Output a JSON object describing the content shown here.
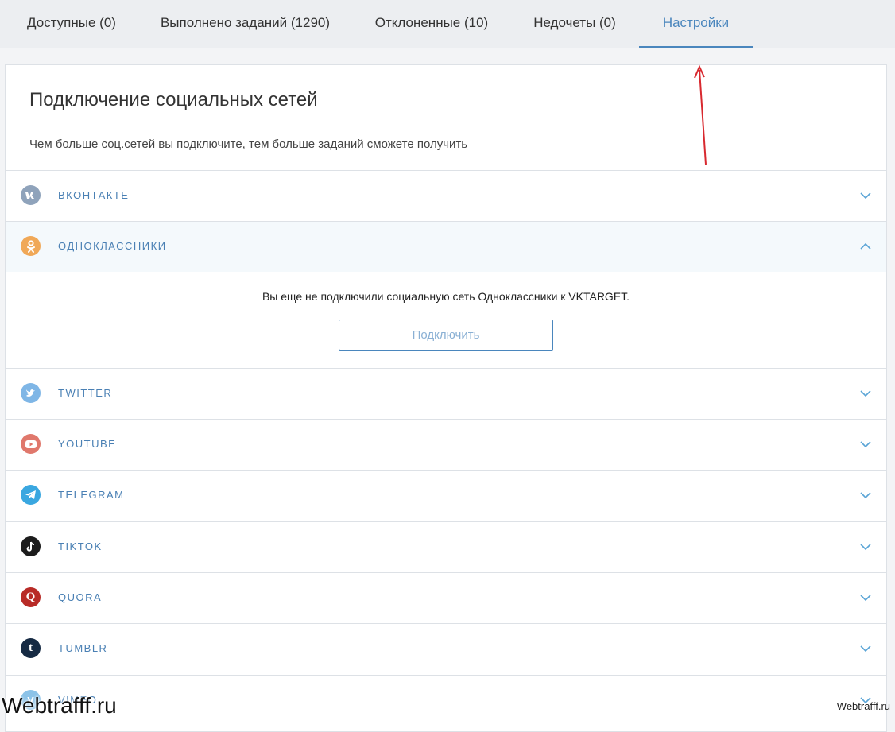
{
  "tabs": [
    {
      "label": "Доступные (0)"
    },
    {
      "label": "Выполнено заданий (1290)"
    },
    {
      "label": "Отклоненные (10)"
    },
    {
      "label": "Недочеты (0)"
    },
    {
      "label": "Настройки",
      "active": true
    }
  ],
  "page": {
    "title": "Подключение социальных сетей",
    "subtitle": "Чем больше соц.сетей вы подключите, тем больше заданий сможете получить"
  },
  "networks": [
    {
      "label": "ВКОНТАКТЕ",
      "icon": "vk-icon",
      "color": "#8fa3bb",
      "glyph": "vk"
    },
    {
      "label": "ОДНОКЛАССНИКИ",
      "icon": "odnoklassniki-icon",
      "color": "#f0a857",
      "glyph": "ok",
      "expanded": true
    },
    {
      "label": "TWITTER",
      "icon": "twitter-icon",
      "color": "#7fb6e6",
      "glyph": "tw"
    },
    {
      "label": "YOUTUBE",
      "icon": "youtube-icon",
      "color": "#e0786c",
      "glyph": "yt"
    },
    {
      "label": "TELEGRAM",
      "icon": "telegram-icon",
      "color": "#3aa7e0",
      "glyph": "tg"
    },
    {
      "label": "TIKTOK",
      "icon": "tiktok-icon",
      "color": "#1c1c1c",
      "glyph": "tt"
    },
    {
      "label": "QUORA",
      "icon": "quora-icon",
      "color": "#b82b27",
      "glyph": "Q"
    },
    {
      "label": "TUMBLR",
      "icon": "tumblr-icon",
      "color": "#162a43",
      "glyph": "t"
    },
    {
      "label": "VIMEO",
      "icon": "vimeo-icon",
      "color": "#8cc3e8",
      "glyph": "v"
    }
  ],
  "expanded_panel": {
    "message": "Вы еще не подключили социальную сеть Одноклассники к VKTARGET.",
    "button_label": "Подключить"
  },
  "watermark": {
    "left": "Webtrafff.ru",
    "right": "Webtrafff.ru"
  },
  "colors": {
    "accent": "#4a86bd",
    "annotation_arrow": "#d8292f"
  }
}
